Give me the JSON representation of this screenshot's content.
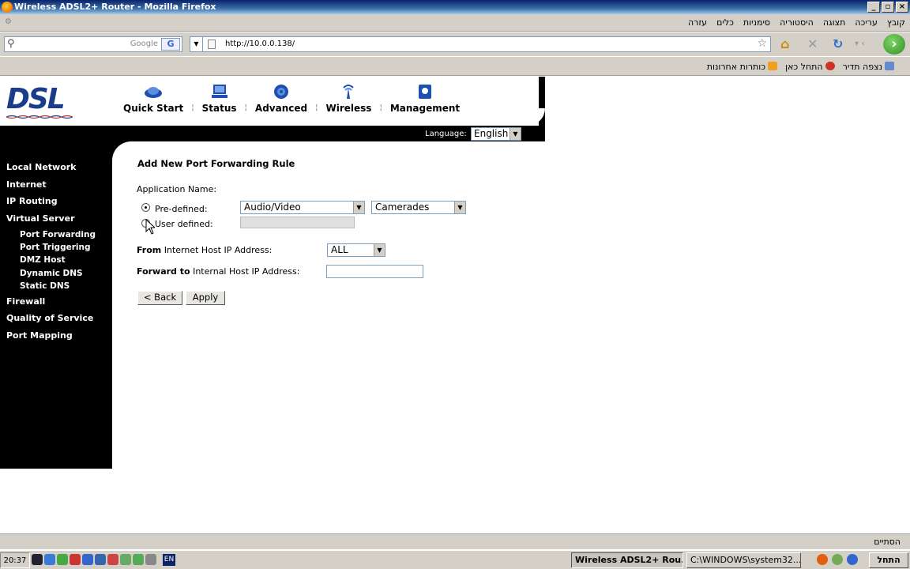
{
  "window": {
    "title": "Wireless ADSL2+ Router - Mozilla Firefox",
    "controls": [
      "_",
      "▫",
      "×"
    ]
  },
  "menu": {
    "items": [
      "קובץ",
      "עריכה",
      "תצוגה",
      "היסטוריה",
      "סימניות",
      "כלים",
      "עזרה"
    ]
  },
  "navbar": {
    "search_engine": "Google",
    "search_button": "G",
    "url": "http://10.0.0.138/"
  },
  "bookmarks": {
    "items": [
      "נצפה תדיר",
      "התחל כאן",
      "כותרות אחרונות"
    ]
  },
  "router": {
    "logo": "DSL",
    "topnav": [
      "Quick Start",
      "Status",
      "Advanced",
      "Wireless",
      "Management"
    ],
    "language_label": "Language:",
    "language_value": "English",
    "sidebar": {
      "main": [
        "Local Network",
        "Internet",
        "IP Routing",
        "Virtual Server"
      ],
      "sub": [
        "Port Forwarding",
        "Port Triggering",
        "DMZ Host",
        "Dynamic DNS",
        "Static DNS"
      ],
      "main2": [
        "Firewall",
        "Quality of Service",
        "Port Mapping"
      ]
    },
    "form": {
      "heading": "Add New Port Forwarding Rule",
      "app_name_label": "Application Name:",
      "predefined_label": "Pre-defined:",
      "predefined_category": "Audio/Video",
      "predefined_app": "Camerades",
      "userdefined_label": "User defined:",
      "from_bold": "From",
      "from_rest": " Internet Host IP Address:",
      "from_value": "ALL",
      "forward_bold": "Forward to",
      "forward_rest": " Internal Host IP Address:",
      "back_button": "< Back",
      "apply_button": "Apply"
    }
  },
  "statusbar": {
    "text": "הסתיים"
  },
  "taskbar": {
    "clock": "20:37",
    "lang": "EN",
    "task1": "Wireless ADSL2+ Rou...",
    "task2": "C:\\WINDOWS\\system32...",
    "start": "התחל"
  }
}
